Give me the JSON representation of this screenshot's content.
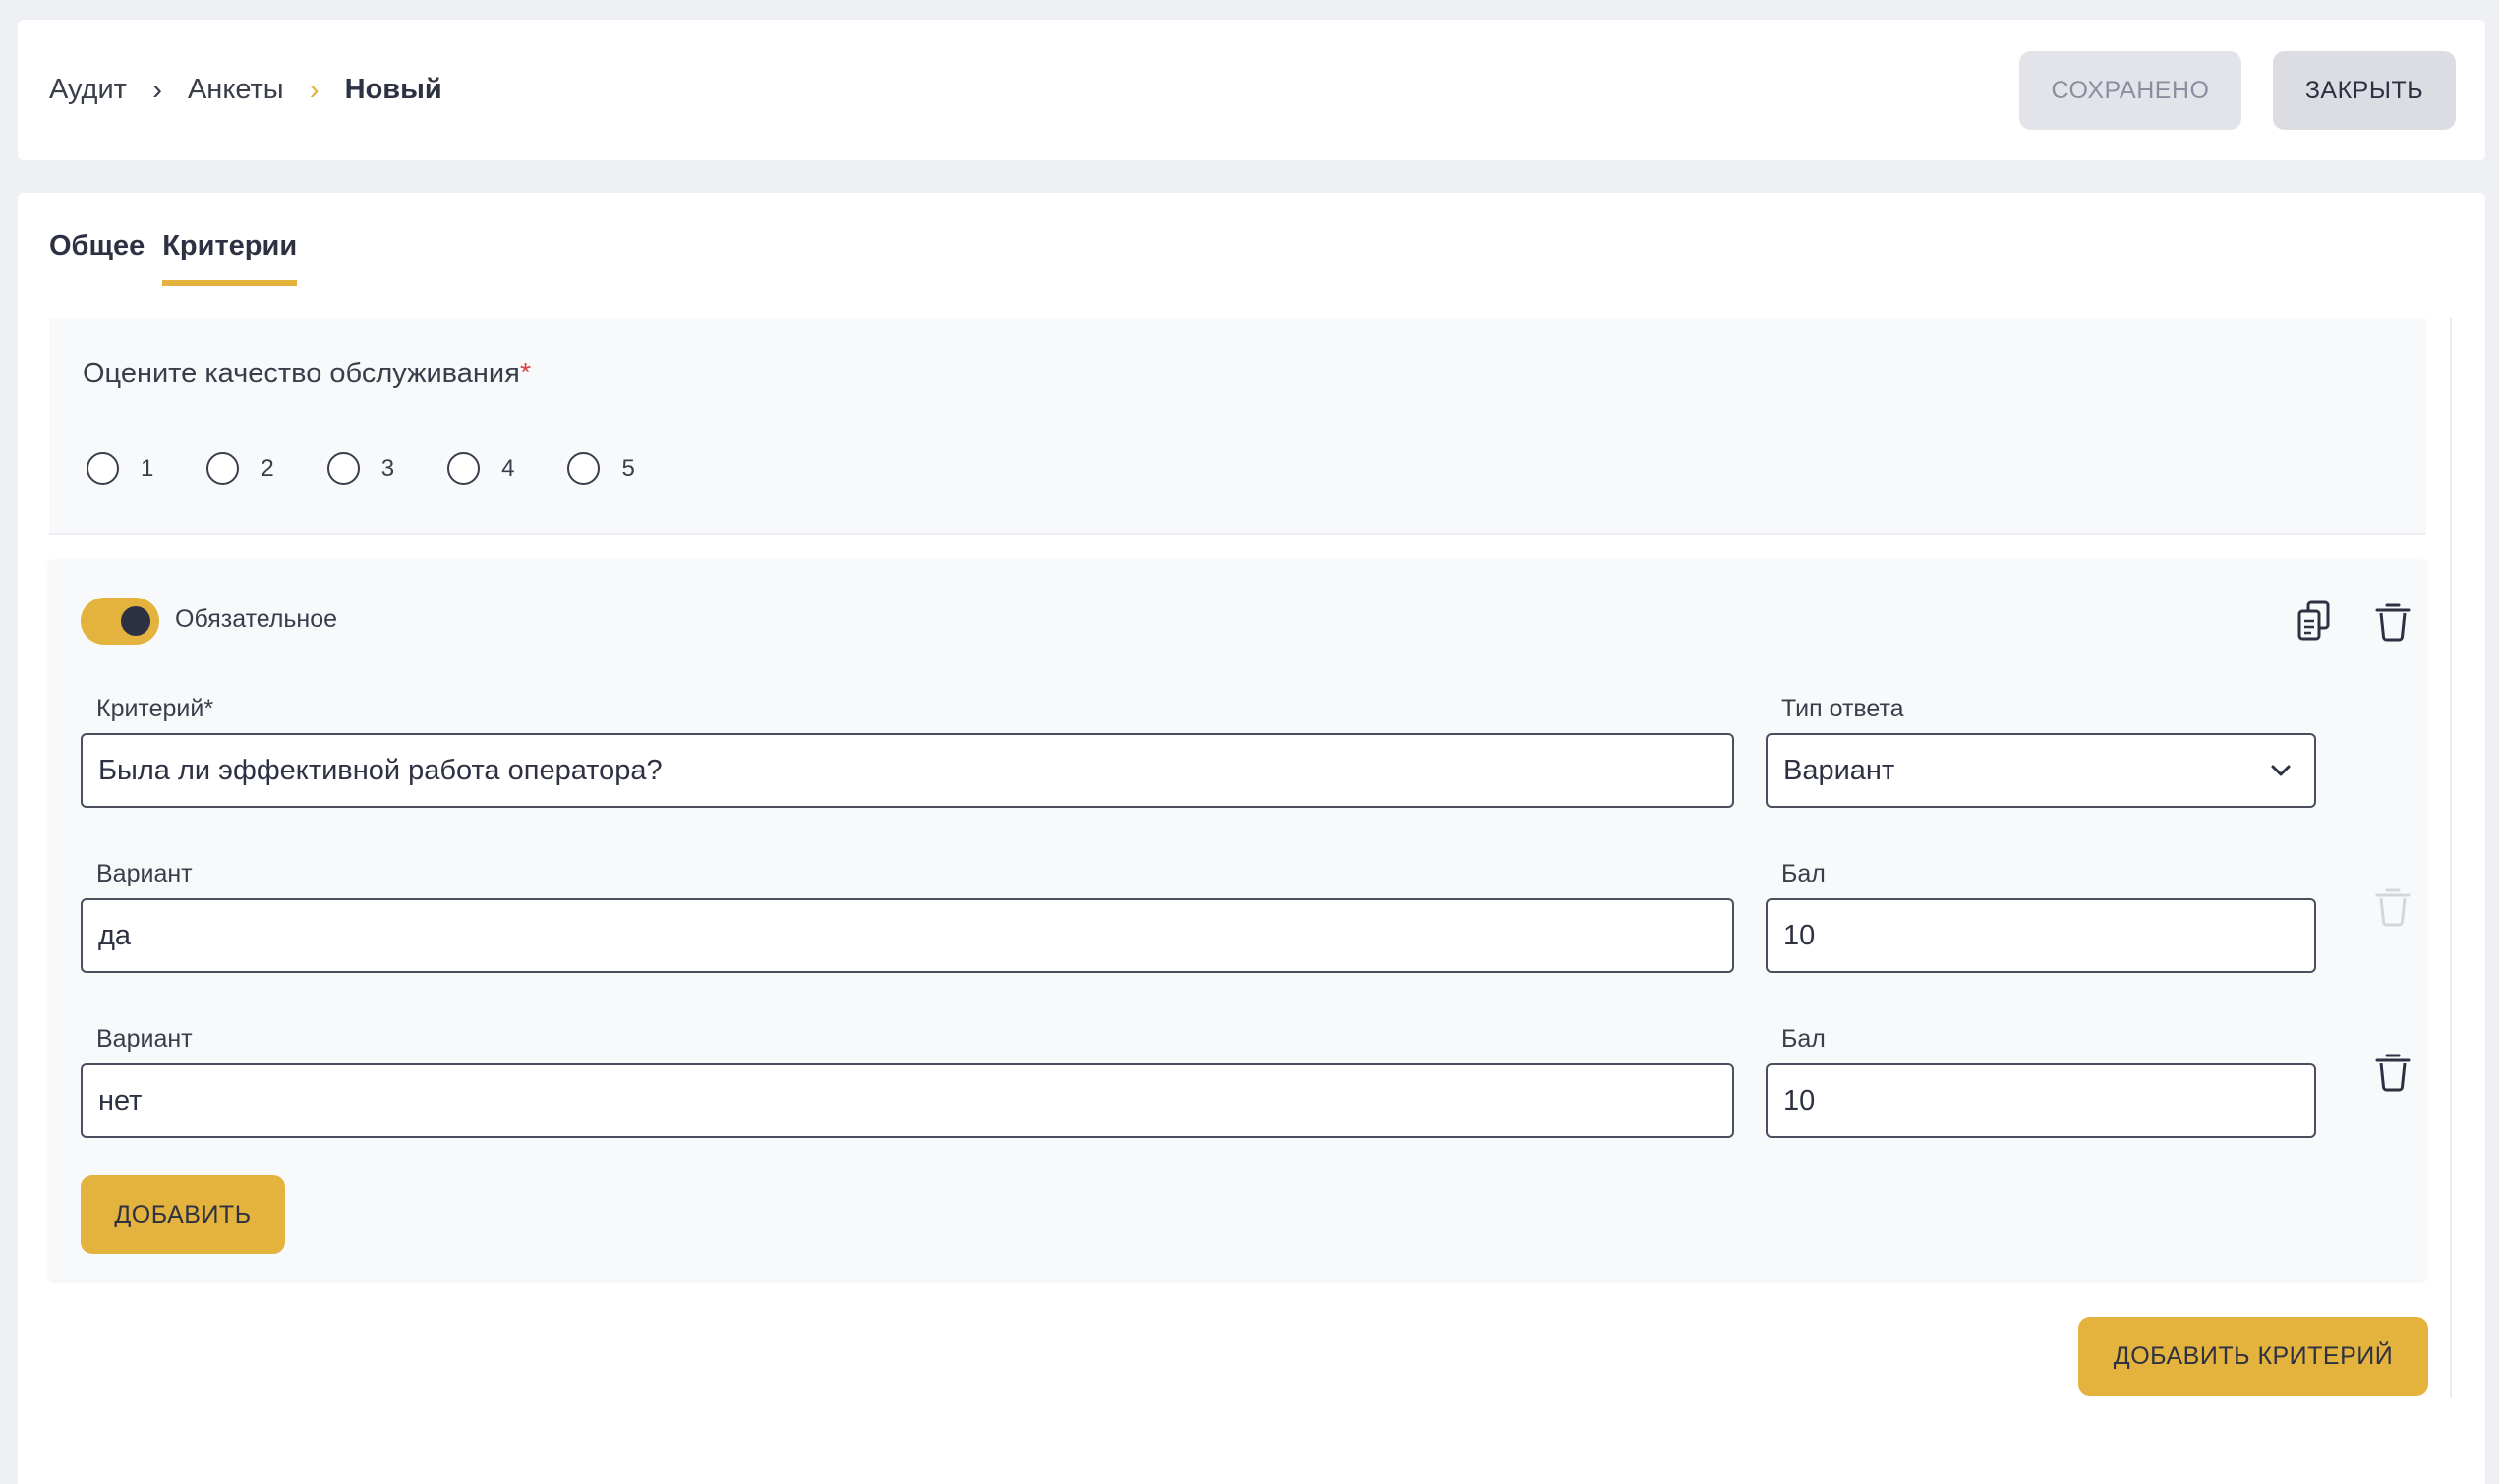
{
  "breadcrumb": [
    "Аудит",
    "Анкеты",
    "Новый"
  ],
  "header": {
    "saved_label": "СОХРАНЕНО",
    "close_label": "ЗАКРЫТЬ"
  },
  "tabs": [
    {
      "label": "Общее",
      "active": false
    },
    {
      "label": "Критерии",
      "active": true
    }
  ],
  "question": {
    "title": "Оцените качество обслуживания",
    "required_mark": "*",
    "options": [
      "1",
      "2",
      "3",
      "4",
      "5"
    ]
  },
  "criterion": {
    "toggle_label": "Обязательное",
    "toggle_on": true,
    "copy_icon": "copy-icon",
    "delete_icon": "trash-icon",
    "criterion_label": "Критерий*",
    "criterion_value": "Была ли эффективной работа оператора?",
    "answer_type_label": "Тип ответа",
    "answer_type_value": "Вариант",
    "variants": [
      {
        "variant_label": "Вариант",
        "variant_value": "да",
        "score_label": "Бал",
        "score_value": "10",
        "delete_enabled": false
      },
      {
        "variant_label": "Вариант",
        "variant_value": "нет",
        "score_label": "Бал",
        "score_value": "10",
        "delete_enabled": true
      }
    ],
    "add_label": "ДОБАВИТЬ"
  },
  "add_criterion_label": "ДОБАВИТЬ КРИТЕРИЙ",
  "colors": {
    "accent": "#e3b33e",
    "text": "#2d3142",
    "background": "#eff0f4",
    "panel": "#f8f9fb"
  }
}
